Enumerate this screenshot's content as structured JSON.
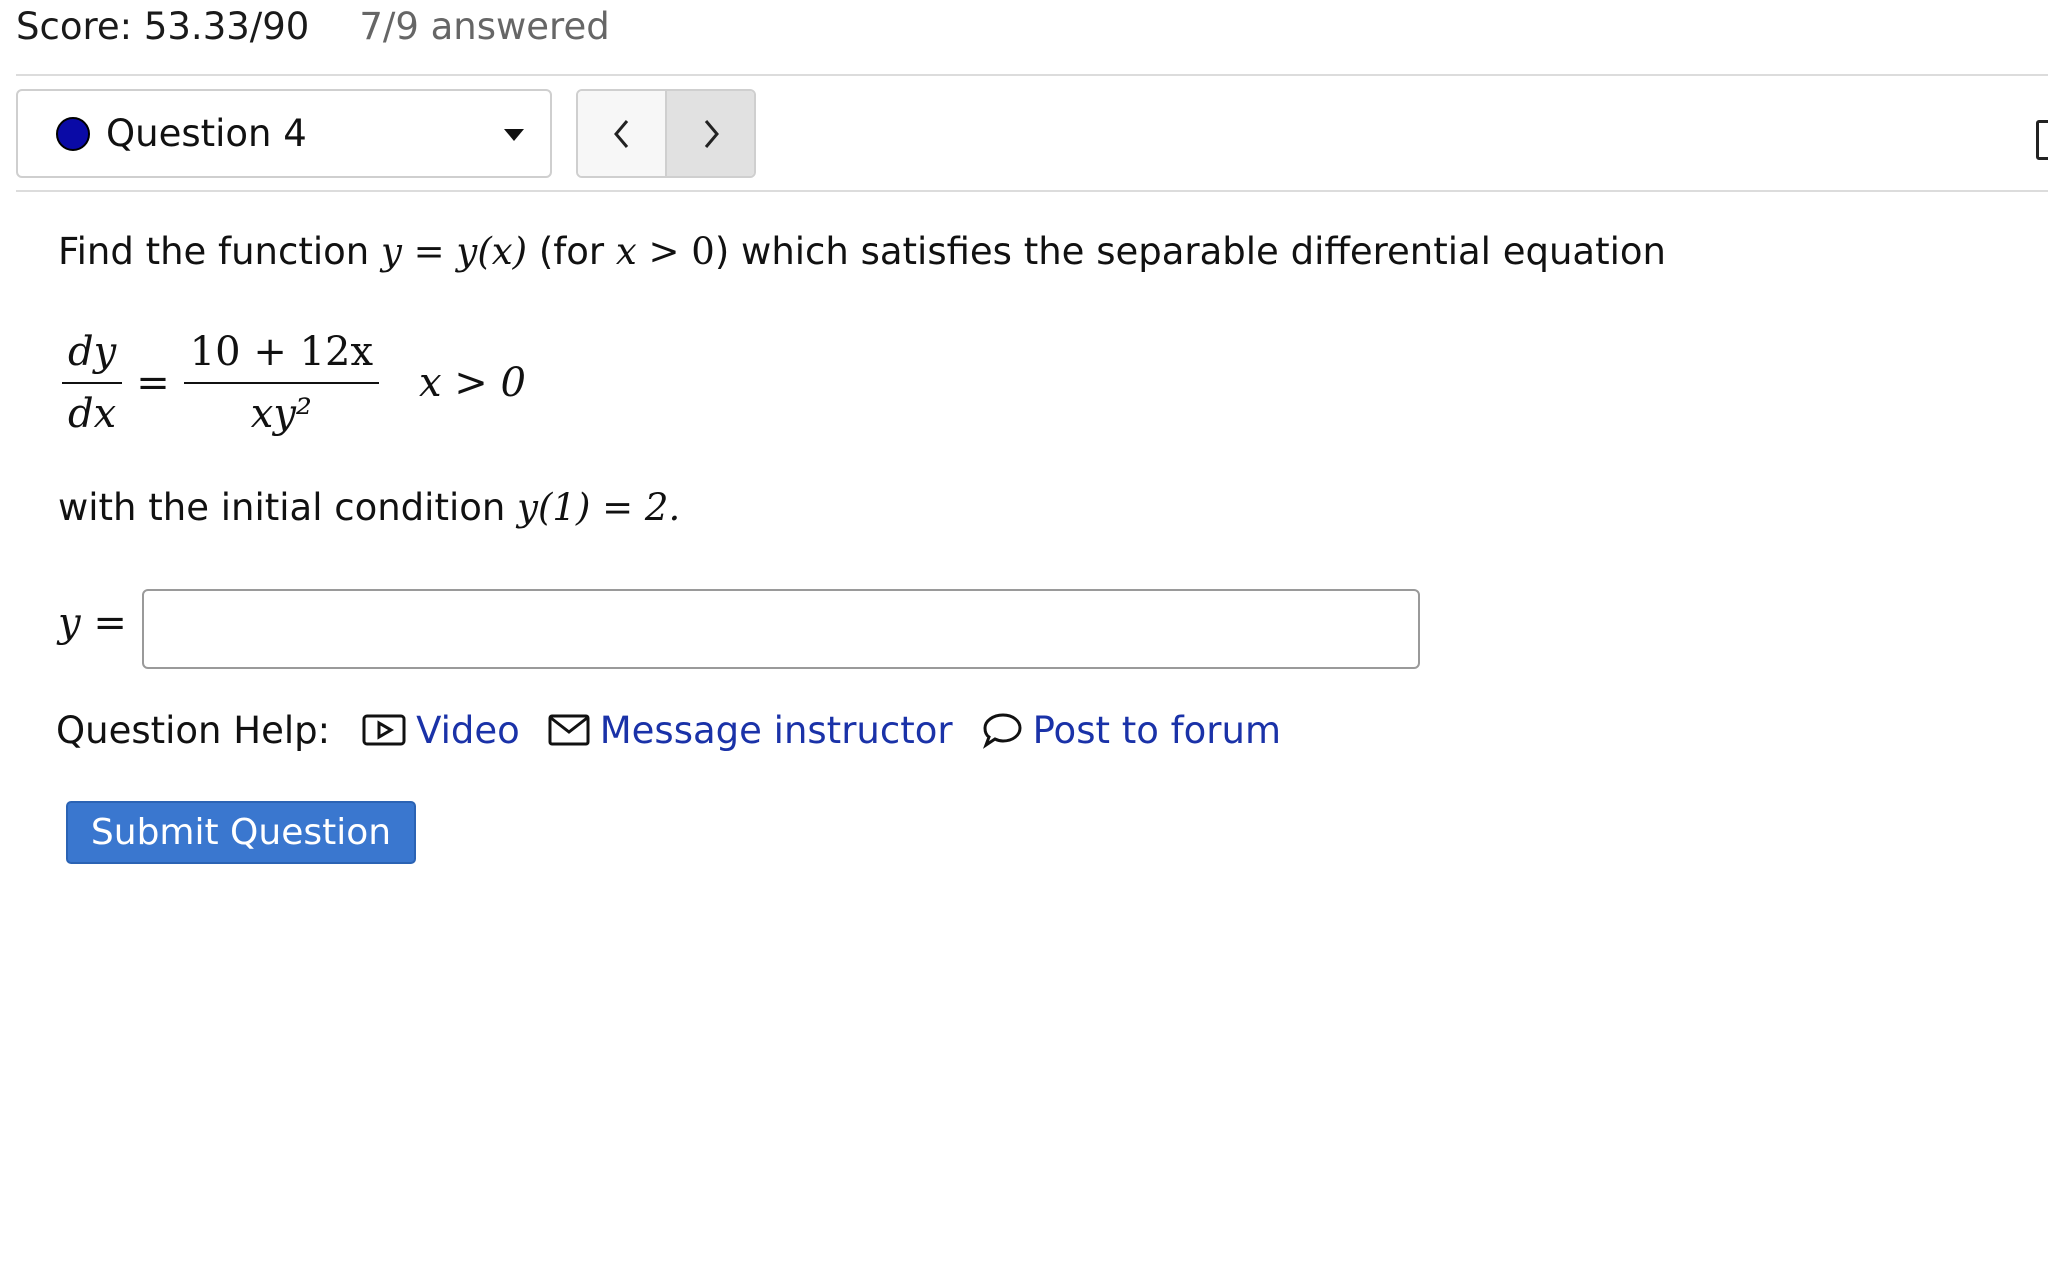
{
  "header": {
    "score": "Score: 53.33/90",
    "answered": "7/9 answered"
  },
  "question_nav": {
    "selected": "Question 4",
    "status_color": "#0a0aa6",
    "prev_glyph": "‹",
    "next_glyph": "›"
  },
  "problem": {
    "intro_1": "Find the function ",
    "y1": "y",
    "eq1": " = ",
    "y2": "y",
    "paren_x": "(x)",
    "intro_2": " (for ",
    "x1": "x",
    "gt0": " > 0",
    "intro_3": ") which satisfies the separable differential equation",
    "frac1_num": "dy",
    "frac1_den": "dx",
    "equals": "=",
    "frac2_num": "10 + 12x",
    "frac2_den": "xy²",
    "condition": "x > 0",
    "line2_text": "with the initial condition ",
    "line2_math": "y(1) = 2.",
    "answer_label": "y ="
  },
  "answer": {
    "value": ""
  },
  "help": {
    "label": "Question Help:",
    "video": "Video",
    "message": "Message instructor",
    "forum": "Post to forum"
  },
  "submit": {
    "label": "Submit Question"
  },
  "colors": {
    "accent": "#3a77cf",
    "link": "#1a32a8"
  }
}
